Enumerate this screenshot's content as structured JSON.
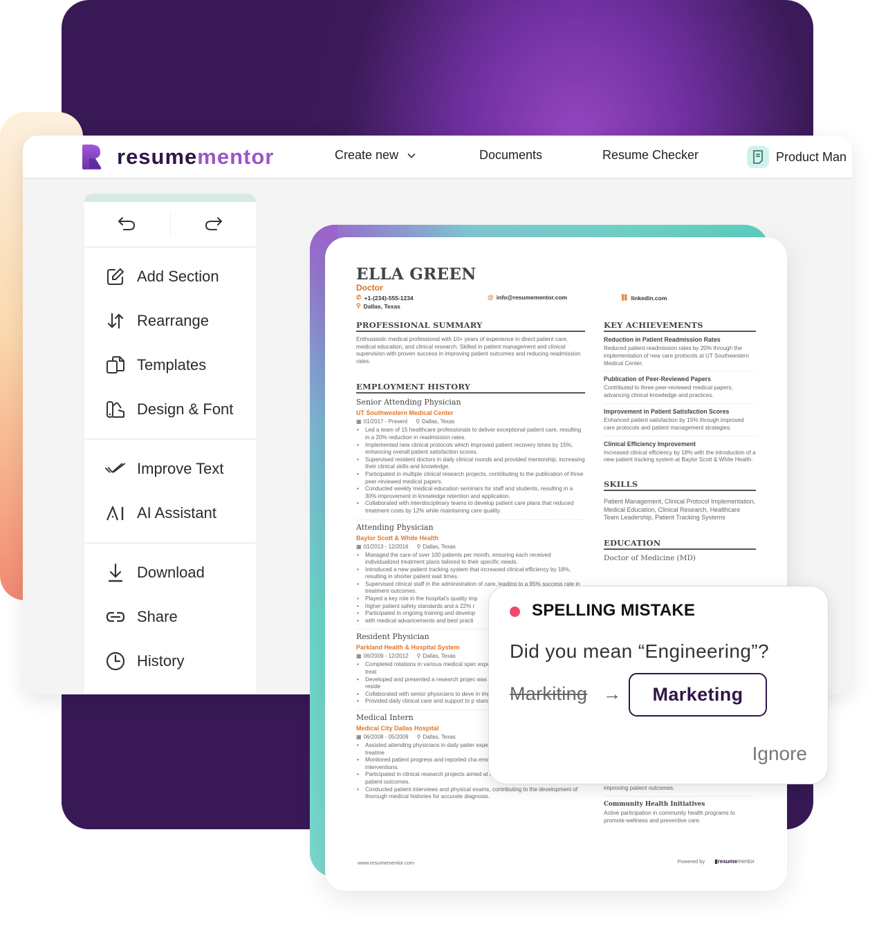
{
  "brand": {
    "logo_text_a": "resume",
    "logo_text_b": "mentor",
    "primary_color": "#2e1647",
    "accent_color": "#9b55c9",
    "orange_accent": "#e0782a",
    "alert_color": "#f04a6a"
  },
  "nav": {
    "create_new": "Create new",
    "documents": "Documents",
    "resume_checker": "Resume Checker",
    "document_name": "Product Man"
  },
  "sidebar": {
    "undo_icon": "undo-icon",
    "redo_icon": "redo-icon",
    "groups": [
      {
        "items": [
          {
            "label": "Add Section",
            "icon": "edit-icon"
          },
          {
            "label": "Rearrange",
            "icon": "sort-arrows-icon"
          },
          {
            "label": "Templates",
            "icon": "templates-icon"
          },
          {
            "label": "Design & Font",
            "icon": "palette-icon"
          }
        ]
      },
      {
        "items": [
          {
            "label": "Improve Text",
            "icon": "double-check-icon"
          },
          {
            "label": "AI Assistant",
            "icon": "ai-icon"
          }
        ]
      },
      {
        "items": [
          {
            "label": "Download",
            "icon": "download-icon"
          },
          {
            "label": "Share",
            "icon": "link-icon"
          },
          {
            "label": "History",
            "icon": "clock-icon"
          }
        ]
      }
    ]
  },
  "resume": {
    "name": "ELLA GREEN",
    "title": "Doctor",
    "phone": "+1-(234)-555-1234",
    "email": "info@resumementor.com",
    "linkedin": "linkedin.com",
    "location": "Dallas, Texas",
    "summary_heading": "PROFESSIONAL SUMMARY",
    "summary": "Enthusiastic medical professional with 10+ years of experience in direct patient care, medical education, and clinical research. Skilled in patient management and clinical supervision with proven success in improving patient outcomes and reducing readmission rates.",
    "employment_heading": "EMPLOYMENT HISTORY",
    "jobs": [
      {
        "title": "Senior Attending Physician",
        "company": "UT Southwestern Medical Center",
        "dates": "01/2017 - Present",
        "location": "Dallas, Texas",
        "bullets": [
          "Led a team of 15 healthcare professionals to deliver exceptional patient care, resulting in a 20% reduction in readmission rates.",
          "Implemented new clinical protocols which improved patient recovery times by 15%, enhancing overall patient satisfaction scores.",
          "Supervised resident doctors in daily clinical rounds and provided mentorship, increasing their clinical skills and knowledge.",
          "Participated in multiple clinical research projects, contributing to the publication of three peer-reviewed medical papers.",
          "Conducted weekly medical education seminars for staff and students, resulting in a 30% improvement in knowledge retention and application.",
          "Collaborated with interdisciplinary teams to develop patient care plans that reduced treatment costs by 12% while maintaining care quality."
        ]
      },
      {
        "title": "Attending Physician",
        "company": "Baylor Scott & White Health",
        "dates": "01/2013 - 12/2016",
        "location": "Dallas, Texas",
        "bullets": [
          "Managed the care of over 100 patients per month, ensuring each received individualized treatment plans tailored to their specific needs.",
          "Introduced a new patient tracking system that increased clinical efficiency by 18%, resulting in shorter patient wait times.",
          "Supervised clinical staff in the administration of care, leading to a 95% success rate in treatment outcomes.",
          "Played a key role in the hospital's quality imp",
          "higher patient safety standards and a 22% r",
          "Participated in ongoing training and develop",
          "with medical advancements and best practi"
        ]
      },
      {
        "title": "Resident Physician",
        "company": "Parkland Health & Hospital System",
        "dates": "06/2009 - 12/2012",
        "location": "Dallas, Texas",
        "bullets": [
          "Completed rotations in various medical spec experience in patient assessment and treat",
          "Developed and presented a research projec was awarded best presentation in the reside",
          "Collaborated with senior physicians to deve in improved patient recovery rates.",
          "Provided daily clinical care and support to p standard of patient satisfaction and care."
        ]
      },
      {
        "title": "Medical Intern",
        "company": "Medical City Dallas Hospital",
        "dates": "06/2008 - 05/2009",
        "location": "Dallas, Texas",
        "bullets": [
          "Assisted attending physicians in daily patier experience in patient diagnosis and treatme",
          "Monitored patient progress and reported cha ensuring timely and appropriate interventions.",
          "Participated in clinical research projects aimed at improving treatment protocols and patient outcomes.",
          "Conducted patient interviews and physical exams, contributing to the development of thorough medical histories for accurate diagnosis."
        ]
      }
    ],
    "achievements_heading": "KEY ACHIEVEMENTS",
    "achievements": [
      {
        "title": "Reduction in Patient Readmission Rates",
        "desc": "Reduced patient readmission rates by 20% through the implementation of new care protocols at UT Southwestern Medical Center."
      },
      {
        "title": "Publication of Peer-Reviewed Papers",
        "desc": "Contributed to three peer-reviewed medical papers, advancing clinical knowledge and practices."
      },
      {
        "title": "Improvement in Patient Satisfaction Scores",
        "desc": "Enhanced patient satisfaction by 15% through improved care protocols and patient management strategies."
      },
      {
        "title": "Clinical Efficiency Improvement",
        "desc": "Increased clinical efficiency by 18% with the introduction of a new patient tracking system at Baylor Scott & White Health."
      }
    ],
    "skills_heading": "SKILLS",
    "skills": "Patient Management, Clinical Protocol Implementation, Medical Education, Clinical Research, Healthcare Team Leadership, Patient Tracking Systems",
    "education_heading": "EDUCATION",
    "education_degree": "Doctor of Medicine (MD)",
    "hidden_tail": "improving patient outcomes.",
    "community_title": "Community Health Initiatives",
    "community_desc": "Active participation in community health programs to promote wellness and preventive care.",
    "footer_url": "www.resumementor.com",
    "footer_powered": "Powered by",
    "footer_logo_a": "resume",
    "footer_logo_b": "mentor"
  },
  "spelling_popup": {
    "heading": "SPELLING MISTAKE",
    "question": "Did you mean “Engineering”?",
    "wrong_word": "Markiting",
    "suggestion": "Marketing",
    "ignore_label": "Ignore"
  }
}
